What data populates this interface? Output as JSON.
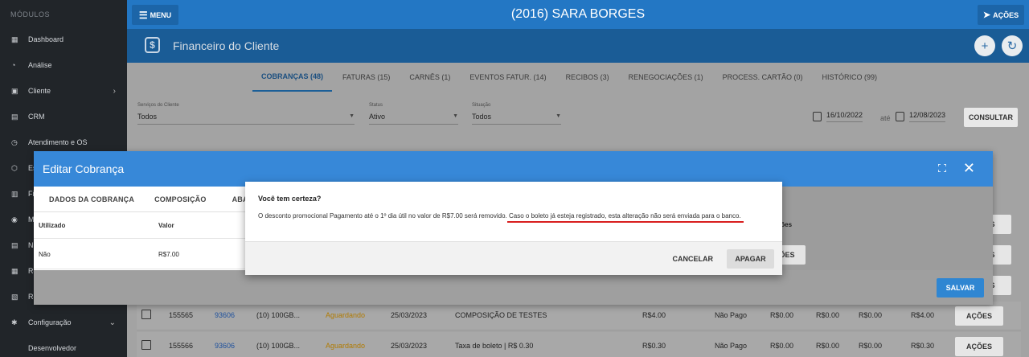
{
  "sidebar": {
    "section_title": "MÓDULOS",
    "items": [
      {
        "label": "Dashboard",
        "icon": "dashboard-icon"
      },
      {
        "label": "Análise",
        "icon": "chart-icon"
      },
      {
        "label": "Cliente",
        "icon": "client-icon",
        "has_chevron": true
      },
      {
        "label": "CRM",
        "icon": "crm-icon"
      },
      {
        "label": "Atendimento e OS",
        "icon": "headset-icon"
      },
      {
        "label": "Es",
        "icon": "box-icon"
      },
      {
        "label": "Fi",
        "icon": "finance-icon"
      },
      {
        "label": "M",
        "icon": "map-icon"
      },
      {
        "label": "N",
        "icon": "doc-icon"
      },
      {
        "label": "Re",
        "icon": "server-icon"
      },
      {
        "label": "Re",
        "icon": "report-icon"
      },
      {
        "label": "Configuração",
        "icon": "gear-icon",
        "has_chevron": true
      },
      {
        "label": "Desenvolvedor",
        "icon": ""
      }
    ]
  },
  "topbar": {
    "menu_label": "MENU",
    "client_name": "(2016) SARA BORGES",
    "acoes_label": "AÇÕES"
  },
  "page": {
    "title": "Financeiro do Cliente",
    "add_icon": "+",
    "refresh_icon": "↻"
  },
  "tabs": [
    {
      "label": "COBRANÇAS (48)",
      "active": true
    },
    {
      "label": "FATURAS (15)"
    },
    {
      "label": "CARNÊS (1)"
    },
    {
      "label": "EVENTOS FATUR. (14)"
    },
    {
      "label": "RECIBOS (3)"
    },
    {
      "label": "RENEGOCIAÇÕES (1)"
    },
    {
      "label": "PROCESS. CARTÃO (0)"
    },
    {
      "label": "HISTÓRICO (99)"
    }
  ],
  "filters": {
    "servicos": {
      "label": "Serviços do Cliente",
      "value": "Todos"
    },
    "status": {
      "label": "Status",
      "value": "Ativo"
    },
    "situacao": {
      "label": "Situação",
      "value": "Todos"
    },
    "date_from": "16/10/2022",
    "ate_label": "até",
    "date_to": "12/08/2023",
    "consultar_label": "CONSULTAR"
  },
  "background_rows": [
    {
      "id": "155565",
      "link": "93606",
      "service": "(10) 100GB...",
      "status": "Aguardando",
      "date": "25/03/2023",
      "desc": "COMPOSIÇÃO DE TESTES",
      "value": "R$4.00",
      "paid": "Não Pago",
      "v1": "R$0.00",
      "v2": "R$0.00",
      "v3": "R$0.00",
      "total": "R$4.00",
      "acoes": "AÇÕES"
    },
    {
      "id": "155566",
      "link": "93606",
      "service": "(10) 100GB...",
      "status": "Aguardando",
      "date": "25/03/2023",
      "desc": "Taxa de boleto | R$ 0.30",
      "value": "R$0.30",
      "paid": "Não Pago",
      "v1": "R$0.00",
      "v2": "R$0.00",
      "v3": "R$0.00",
      "total": "R$0.30",
      "acoes": "AÇÕES"
    }
  ],
  "background_acoes": [
    "ÕES",
    "ÕES",
    "ÕES"
  ],
  "edit_dialog": {
    "title": "Editar Cobrança",
    "tabs": [
      "DADOS DA COBRANÇA",
      "COMPOSIÇÃO",
      "ABATES"
    ],
    "headers": {
      "utilizado": "Utilizado",
      "valor": "Valor",
      "acoes": "Ações"
    },
    "row": {
      "utilizado": "Não",
      "valor": "R$7.00",
      "acoes": "AÇÕES"
    },
    "salvar_label": "SALVAR"
  },
  "confirm_dialog": {
    "title": "Você tem certeza?",
    "message_part1": "O desconto promocional Pagamento até o 1º dia útil no valor de R$7.00 será removido. ",
    "message_part2": "Caso o boleto já esteja registrado, esta alteração não será enviada para o banco.",
    "cancel_label": "CANCELAR",
    "confirm_label": "APAGAR"
  },
  "colors": {
    "topbar": "#2377c4",
    "sidebar": "#212529",
    "dialog_header": "#3788d8",
    "primary_button": "#2f86d2",
    "warning_underline": "#d81e1e",
    "status_waiting": "#b07a00",
    "link": "#1c4f9c"
  }
}
